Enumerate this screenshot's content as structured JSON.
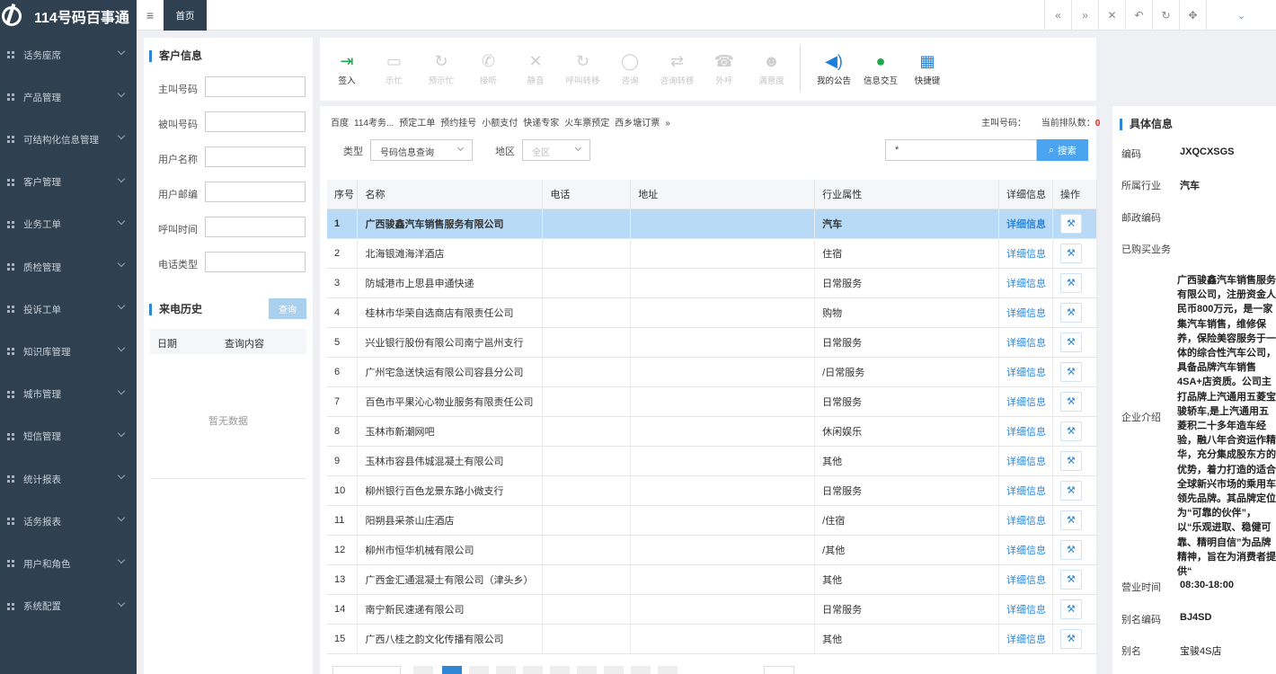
{
  "app": {
    "title": "114号码百事通"
  },
  "sidebar": {
    "items": [
      {
        "label": "话务座席"
      },
      {
        "label": "产品管理"
      },
      {
        "label": "可结构化信息管理"
      },
      {
        "label": "客户管理"
      },
      {
        "label": "业务工单"
      },
      {
        "label": "质检管理"
      },
      {
        "label": "投诉工单"
      },
      {
        "label": "知识库管理"
      },
      {
        "label": "城市管理"
      },
      {
        "label": "短信管理"
      },
      {
        "label": "统计报表"
      },
      {
        "label": "话务报表"
      },
      {
        "label": "用户和角色"
      },
      {
        "label": "系统配置"
      }
    ]
  },
  "topbar": {
    "home_tab": "首页"
  },
  "customer_info": {
    "title": "客户信息",
    "fields": [
      {
        "label": "主叫号码",
        "value": ""
      },
      {
        "label": "被叫号码",
        "value": ""
      },
      {
        "label": "用户名称",
        "value": ""
      },
      {
        "label": "用户邮编",
        "value": ""
      },
      {
        "label": "呼叫时间",
        "value": ""
      },
      {
        "label": "电话类型",
        "value": ""
      }
    ]
  },
  "call_history": {
    "title": "来电历史",
    "query_button": "查询",
    "columns": [
      "日期",
      "查询内容"
    ],
    "empty_text": "暂无数据"
  },
  "toolbar": {
    "tools": [
      {
        "label": "签入",
        "icon": "sign-in-icon",
        "enabled": true
      },
      {
        "label": "示忙",
        "icon": "busy-icon",
        "enabled": false
      },
      {
        "label": "预示忙",
        "icon": "pre-busy-icon",
        "enabled": false
      },
      {
        "label": "接听",
        "icon": "answer-icon",
        "enabled": false
      },
      {
        "label": "静音",
        "icon": "mute-icon",
        "enabled": false
      },
      {
        "label": "呼叫转移",
        "icon": "transfer-icon",
        "enabled": false
      },
      {
        "label": "咨询",
        "icon": "consult-icon",
        "enabled": false
      },
      {
        "label": "咨询转移",
        "icon": "consult-transfer-icon",
        "enabled": false
      },
      {
        "label": "外呼",
        "icon": "outbound-icon",
        "enabled": false
      },
      {
        "label": "满意度",
        "icon": "satisfaction-icon",
        "enabled": false
      },
      {
        "label": "我的公告",
        "icon": "announcement-icon",
        "enabled": true
      },
      {
        "label": "信息交互",
        "icon": "wechat-icon",
        "enabled": true
      },
      {
        "label": "快捷键",
        "icon": "grid-icon",
        "enabled": true
      }
    ]
  },
  "search": {
    "quicklinks": [
      "百度",
      "114考务...",
      "预定工单",
      "预约挂号",
      "小额支付",
      "快递专家",
      "火车票预定",
      "西乡塘订票",
      "»"
    ],
    "caller_label": "主叫号码：",
    "queue_label": "当前排队数：",
    "queue_count": "0",
    "type_label": "类型",
    "type_value": "号码信息查询",
    "area_label": "地区",
    "area_value": "全区",
    "query_value": "*",
    "search_button": "搜索"
  },
  "table": {
    "columns": [
      "序号",
      "名称",
      "电话",
      "地址",
      "行业属性",
      "详细信息",
      "操作"
    ],
    "detail_label": "详细信息",
    "rows": [
      {
        "no": "1",
        "name": "广西骏鑫汽车销售服务有限公司",
        "phone": "",
        "address": "",
        "industry": "汽车"
      },
      {
        "no": "2",
        "name": "北海银滩海洋酒店",
        "phone": "",
        "address": "",
        "industry": "住宿"
      },
      {
        "no": "3",
        "name": "防城港市上思县申通快递",
        "phone": "",
        "address": "",
        "industry": "日常服务"
      },
      {
        "no": "4",
        "name": "桂林市华荣自选商店有限责任公司",
        "phone": "",
        "address": "",
        "industry": "购物"
      },
      {
        "no": "5",
        "name": "兴业银行股份有限公司南宁邕州支行",
        "phone": "",
        "address": "",
        "industry": "日常服务"
      },
      {
        "no": "6",
        "name": "广州宅急送快运有限公司容县分公司",
        "phone": "",
        "address": "",
        "industry": "/日常服务"
      },
      {
        "no": "7",
        "name": "百色市平果沁心物业服务有限责任公司",
        "phone": "",
        "address": "",
        "industry": "日常服务"
      },
      {
        "no": "8",
        "name": "玉林市新潮网吧",
        "phone": "",
        "address": "",
        "industry": "休闲娱乐"
      },
      {
        "no": "9",
        "name": "玉林市容县伟城混凝土有限公司",
        "phone": "",
        "address": "",
        "industry": "其他"
      },
      {
        "no": "10",
        "name": "柳州银行百色龙景东路小微支行",
        "phone": "",
        "address": "",
        "industry": "日常服务"
      },
      {
        "no": "11",
        "name": "阳朔县采茶山庄酒店",
        "phone": "",
        "address": "",
        "industry": "/住宿"
      },
      {
        "no": "12",
        "name": "柳州市恒华机械有限公司",
        "phone": "",
        "address": "",
        "industry": "/其他"
      },
      {
        "no": "13",
        "name": "广西金汇通混凝土有限公司（津头乡）",
        "phone": "",
        "address": "",
        "industry": "其他"
      },
      {
        "no": "14",
        "name": "南宁新民速递有限公司",
        "phone": "",
        "address": "",
        "industry": "日常服务"
      },
      {
        "no": "15",
        "name": "广西八桂之韵文化传播有限公司",
        "phone": "",
        "address": "",
        "industry": "其他"
      }
    ]
  },
  "details": {
    "title": "具体信息",
    "code_label": "编码",
    "code": "JXQCXSGS",
    "industry_label": "所属行业",
    "industry": "汽车",
    "postal_label": "邮政编码",
    "postal": "",
    "purchased_label": "已购买业务",
    "purchased": "",
    "intro_label": "企业介绍",
    "intro": "广西骏鑫汽车销售服务有限公司，注册资金人民币800万元，是一家集汽车销售，维修保养，保险美容服务于一体的综合性汽车公司，具备品牌汽车销售4SA+店资质。公司主打品牌上汽通用五菱宝骏轿车,是上汽通用五菱积二十多年造车经验，融八年合资运作精华，充分集成股东方的优势，着力打造的适合全球新兴市场的乘用车领先品牌。其品牌定位为“可靠的伙伴”，以“乐观进取、稳健可靠、精明自信”为品牌精神，旨在为消费者提供“",
    "hours_label": "营业时间",
    "hours": "08:30-18:00",
    "alias_code_label": "别名编码",
    "alias_code": "BJ4SD",
    "alias_label": "别名",
    "alias": "宝骏4S店"
  }
}
